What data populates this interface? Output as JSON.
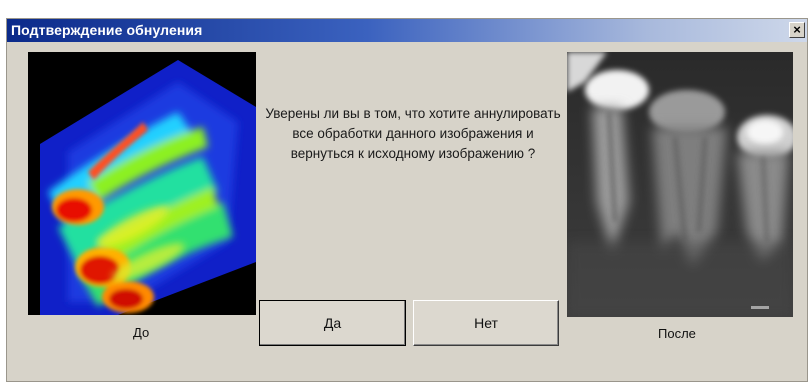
{
  "window": {
    "title": "Подтверждение обнуления",
    "close_glyph": "×",
    "title_gradient": [
      "#0b2a8a",
      "#ced8ea"
    ],
    "background": "#d7d3c9"
  },
  "message": "Уверены ли вы в том, что хотите аннулировать все обработки данного изображения и вернуться к исходному изображению ?",
  "before": {
    "caption": "До",
    "image": "false-color-dental-xray"
  },
  "after": {
    "caption": "После",
    "image": "grayscale-dental-xray"
  },
  "buttons": {
    "yes": "Да",
    "no": "Нет"
  }
}
